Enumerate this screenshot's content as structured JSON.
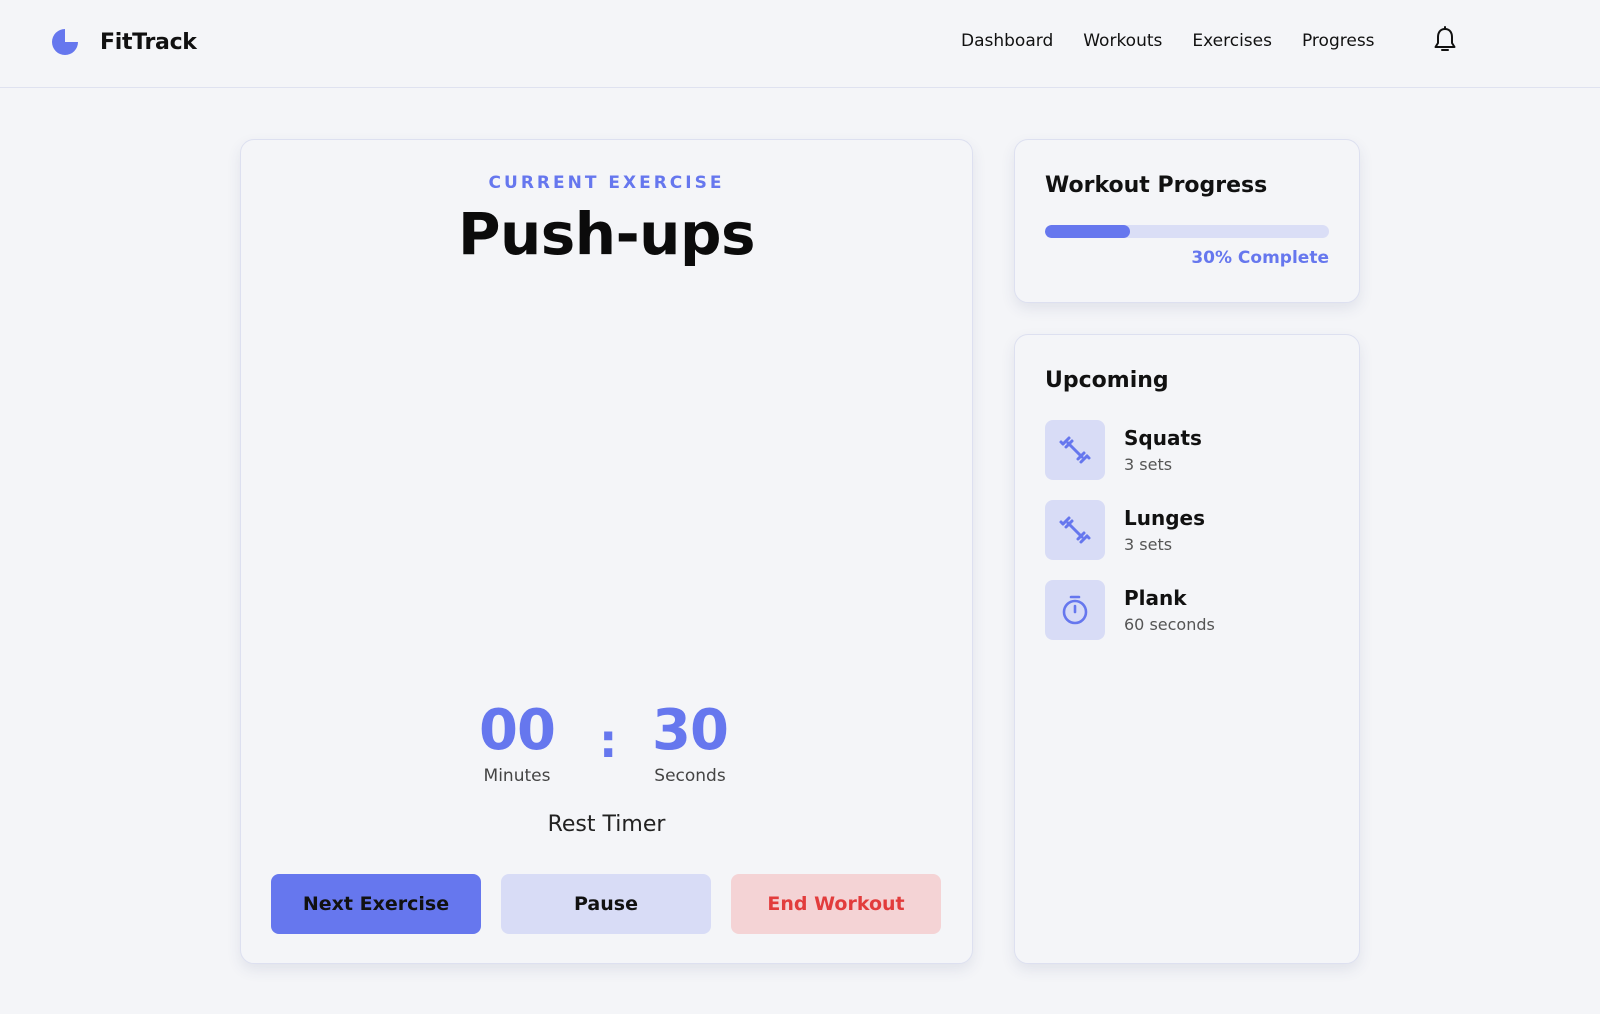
{
  "app": {
    "name": "FitTrack"
  },
  "nav": {
    "links": [
      "Dashboard",
      "Workouts",
      "Exercises",
      "Progress"
    ],
    "notification_icon": "bell-icon"
  },
  "current": {
    "eyebrow": "CURRENT EXERCISE",
    "exercise": "Push-ups",
    "timer": {
      "minutes": "00",
      "minutes_label": "Minutes",
      "separator": ":",
      "seconds": "30",
      "seconds_label": "Seconds"
    },
    "timer_label": "Rest Timer",
    "buttons": {
      "next": "Next Exercise",
      "pause": "Pause",
      "end": "End Workout"
    }
  },
  "progress": {
    "heading": "Workout Progress",
    "percent": 30,
    "label": "30% Complete"
  },
  "upcoming": {
    "heading": "Upcoming",
    "items": [
      {
        "name": "Squats",
        "detail": "3 sets",
        "icon": "dumbbell-icon"
      },
      {
        "name": "Lunges",
        "detail": "3 sets",
        "icon": "dumbbell-icon"
      },
      {
        "name": "Plank",
        "detail": "60 seconds",
        "icon": "stopwatch-icon"
      }
    ]
  },
  "colors": {
    "accent": "#6677ee",
    "accent_light": "#d8dcf6",
    "danger": "#e23c3c",
    "danger_light": "#f4d3d5",
    "background": "#f4f5f8"
  }
}
